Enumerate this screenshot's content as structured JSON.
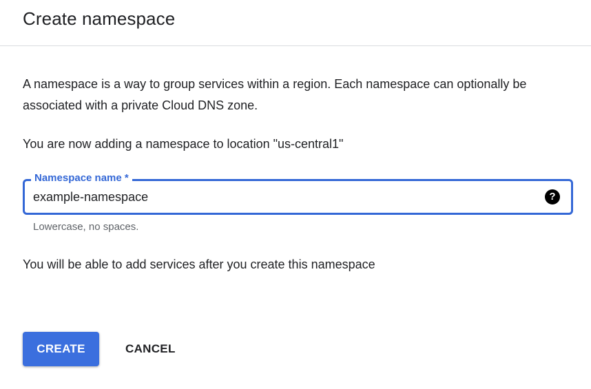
{
  "dialog": {
    "title": "Create namespace",
    "description": "A namespace is a way to group services within a region. Each namespace can optionally be associated with a private Cloud DNS zone.",
    "location_text": "You are now adding a namespace to location \"us-central1\"",
    "namespace_field": {
      "label": "Namespace name *",
      "value": "example-namespace",
      "hint": "Lowercase, no spaces.",
      "help_icon": "help-icon",
      "help_glyph": "?"
    },
    "services_note": "You will be able to add services after you create this namespace",
    "actions": {
      "create_label": "CREATE",
      "cancel_label": "CANCEL"
    }
  },
  "colors": {
    "accent": "#3367d6",
    "primary_button": "#3b6fde",
    "text": "#202124",
    "hint_text": "#5f6368",
    "divider": "#dadce0"
  }
}
